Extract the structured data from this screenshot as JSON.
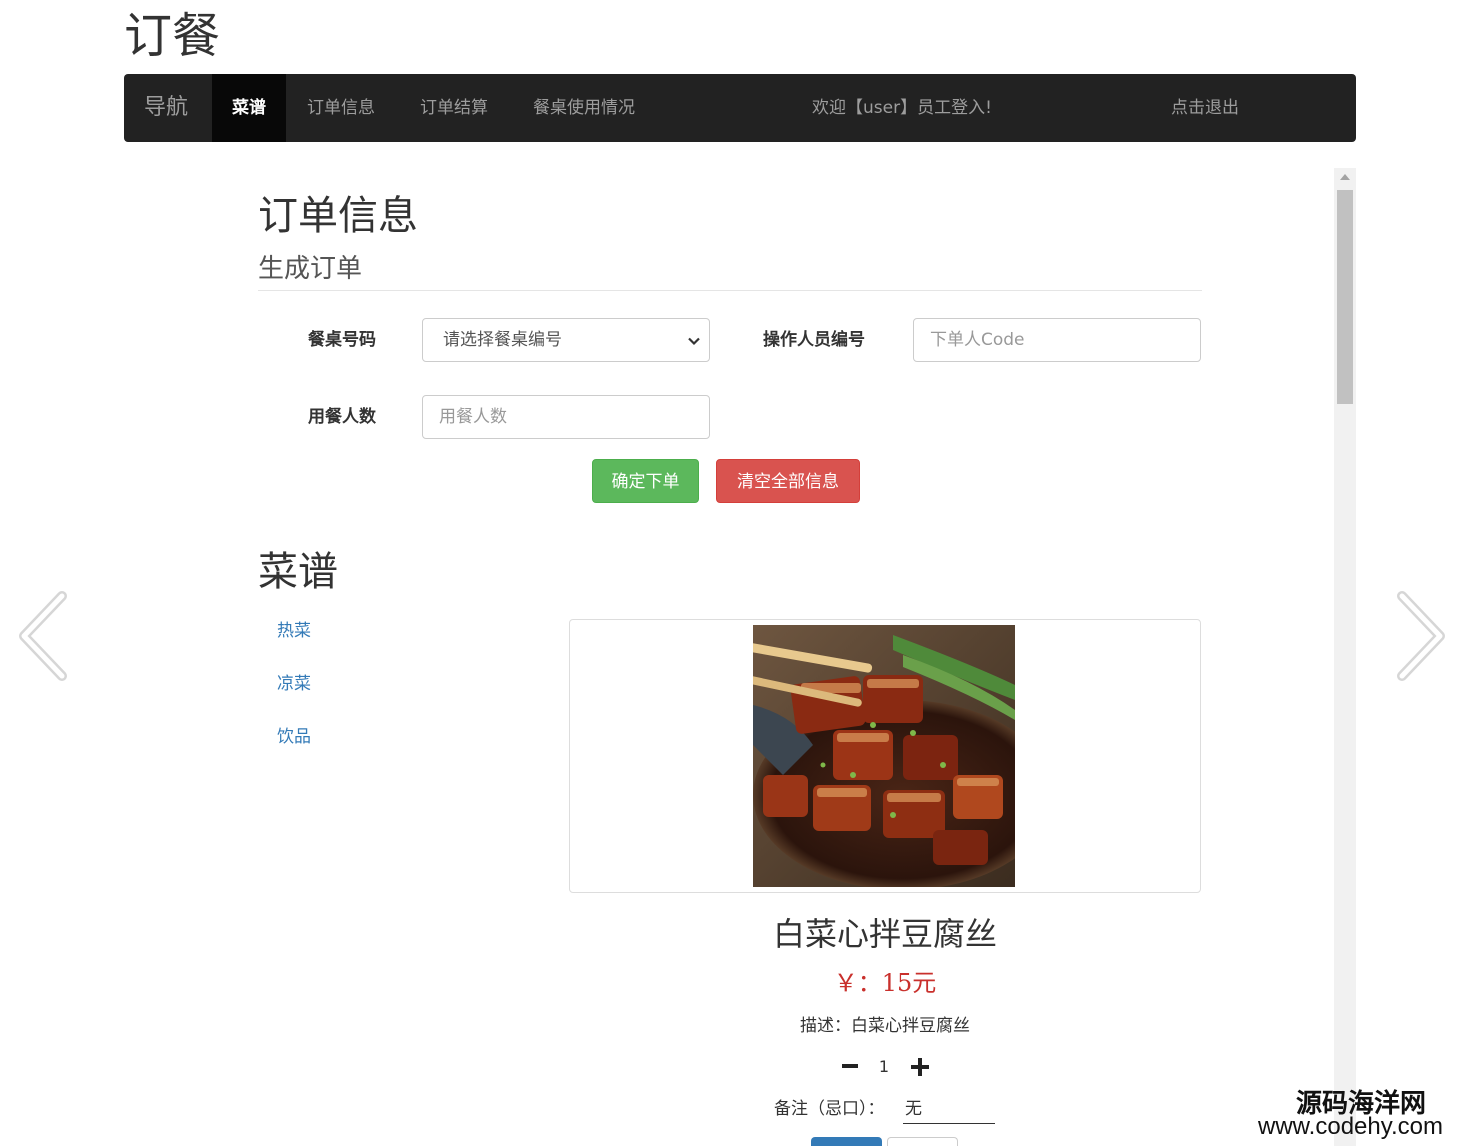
{
  "site": {
    "title": "订餐"
  },
  "navbar": {
    "brand": "导航",
    "items": [
      {
        "label": "菜谱",
        "active": true
      },
      {
        "label": "订单信息",
        "active": false
      },
      {
        "label": "订单结算",
        "active": false
      },
      {
        "label": "餐桌使用情况",
        "active": false
      }
    ],
    "welcome": "欢迎【user】员工登入!",
    "logout": "点击退出"
  },
  "order_section": {
    "title": "订单信息",
    "subtitle": "生成订单",
    "table_label": "餐桌号码",
    "table_select": "请选择餐桌编号",
    "operator_label": "操作人员编号",
    "operator_placeholder": "下单人Code",
    "diners_label": "用餐人数",
    "diners_placeholder": "用餐人数",
    "confirm_button": "确定下单",
    "clear_button": "清空全部信息"
  },
  "menu_section": {
    "title": "菜谱",
    "categories": [
      "热菜",
      "凉菜",
      "饮品"
    ],
    "dish": {
      "name": "白菜心拌豆腐丝",
      "price": "￥：15元",
      "description": "描述：白菜心拌豆腐丝",
      "quantity": "1",
      "note_label": "备注（忌口）：",
      "note_value": "无"
    }
  },
  "watermark": {
    "line1": "源码海洋网",
    "line2": "www.codehy.com"
  },
  "colors": {
    "navbar": "#222222",
    "active_tab": "#080808",
    "link": "#337ab7",
    "success": "#5cb85c",
    "danger": "#d9534f",
    "price": "#c9302c"
  }
}
